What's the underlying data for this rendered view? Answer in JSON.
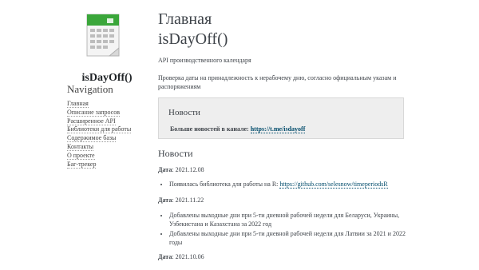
{
  "sidebar": {
    "brand": "isDayOff()",
    "nav_title": "Navigation",
    "nav_items": [
      "Главная",
      "Описание запросов",
      "Расширенное API",
      "Библиотеки для работы",
      "Содержимое базы",
      "Контакты",
      "О проекте",
      "Баг-трекер"
    ]
  },
  "main": {
    "title_line1": "Главная",
    "title_line2": "isDayOff()",
    "subtitle": "API производственного календаря",
    "description": "Проверка даты на принадлежность к нерабочему дню, согласно официальным указам и распоряжениям",
    "news_box": {
      "title": "Новости",
      "text_prefix": "Больше новостей в канале: ",
      "link": "https://t.me/isdayoff"
    },
    "news_heading": "Новости",
    "date_label": "Дата",
    "entries": [
      {
        "date": "2021.12.08",
        "items": [
          {
            "prefix": "Появилась библиотека для работы на R: ",
            "link": "https://github.com/selesnow/timeperiodsR"
          }
        ]
      },
      {
        "date": "2021.11.22",
        "items": [
          {
            "prefix": "Добавлены выходные дни при 5-ти дневной рабочей недели для Беларуси, Украины, Узбекистана и Казахстана за 2022 год",
            "link": ""
          },
          {
            "prefix": "Добавлены выходные дни при 5-ти дневной рабочей недели для Латвии за 2021 и 2022 годы",
            "link": ""
          }
        ]
      },
      {
        "date": "2021.10.06",
        "items": []
      }
    ]
  },
  "colors": {
    "link": "#004b6b",
    "box_bg": "#eeeeee",
    "logo_green": "#3aa63a"
  }
}
